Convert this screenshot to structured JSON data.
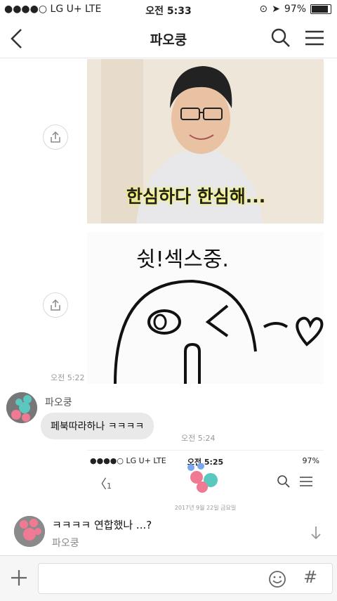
{
  "status_bar": {
    "carrier": "●●●●○ LG U+   LTE",
    "time": "오전 5:33",
    "battery": "97%",
    "battery_level": 0.97
  },
  "header": {
    "title": "파오쿵"
  },
  "messages": {
    "image1_caption": "한심하다 한심해...",
    "image2_caption": "쉿!섹스중.",
    "time1": "오전 5:22",
    "sender_name": "파오쿵",
    "bubble_text": "페북따라하나 ㅋㅋㅋㅋ",
    "time2": "오전 5:24"
  },
  "embedded_screenshot": {
    "carrier": "●●●●○ LG U+   LTE",
    "time": "오전 5:25",
    "battery": "97%",
    "back_count": "1",
    "date": "2017년 9월 22일 금요일"
  },
  "notification": {
    "text": "ㅋㅋㅋㅋ 연합했나 ...?",
    "sender": "파오쿵"
  },
  "colors": {
    "bubble": "#e9e9e9",
    "nav_border": "#e5e5e5"
  }
}
